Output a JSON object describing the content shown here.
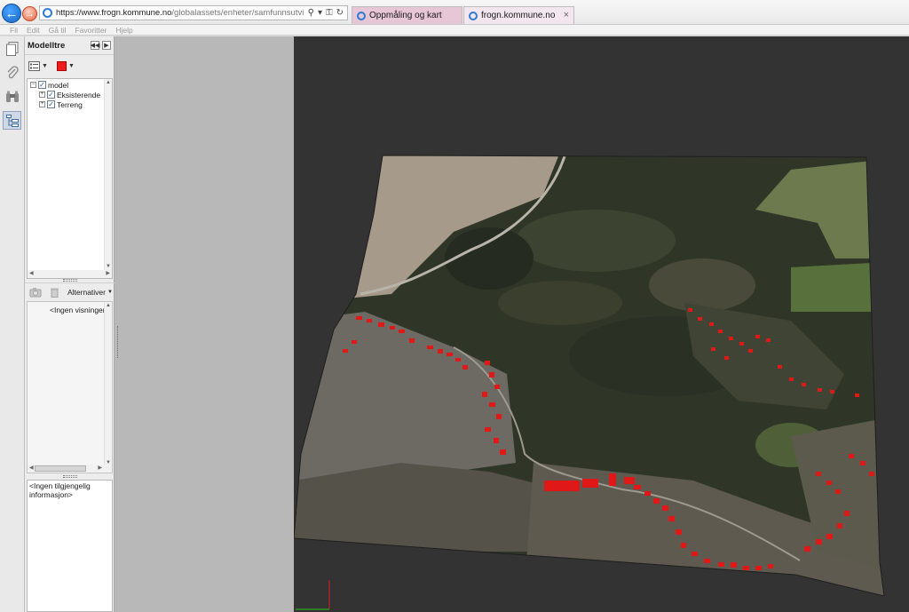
{
  "browser": {
    "url_prefix": "https://www.frogn.kommune.no",
    "url_path": "/globalassets/enheter/samfunnsutvikling/bilder-og-",
    "tabs": [
      {
        "label": "Oppmåling og kart",
        "active": false
      },
      {
        "label": "frogn.kommune.no",
        "active": true
      }
    ],
    "close_glyph": "×"
  },
  "menubar": {
    "items": [
      "Fil",
      "Edit",
      "Gå til",
      "Favoritter",
      "Hjelp"
    ]
  },
  "model_panel": {
    "title": "Modelltre",
    "tree": [
      {
        "label": "model",
        "checked": true
      },
      {
        "label": "Eksisterende",
        "checked": true
      },
      {
        "label": "Terreng",
        "checked": true
      }
    ],
    "alt_label": "Alternativer",
    "no_views": "<Ingen visninger>",
    "info_text": "<Ingen tilgjengelig informasjon>"
  },
  "colors": {
    "accent_red": "#ee1c1c",
    "viewport_bg": "#333333",
    "panel_bg": "#ececec"
  }
}
